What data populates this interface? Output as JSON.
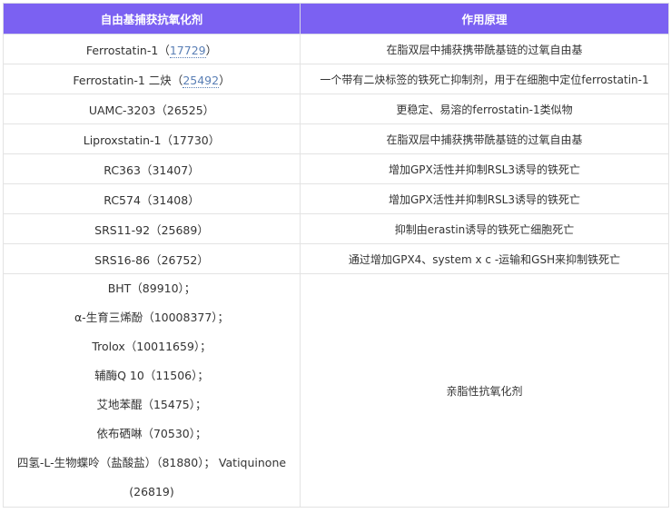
{
  "header": {
    "col1": "自由基捕获抗氧化剂",
    "col2": "作用原理"
  },
  "rows": [
    {
      "name": "Ferrostatin-1",
      "code": "17729",
      "link": true,
      "mechanism": "在脂双层中捕获携带酰基链的过氧自由基"
    },
    {
      "name": "Ferrostatin-1 二炔",
      "code": "25492",
      "link": true,
      "mechanism": "一个带有二炔标签的铁死亡抑制剂，用于在细胞中定位ferrostatin-1"
    },
    {
      "name": "UAMC-3203",
      "code": "26525",
      "link": false,
      "mechanism": "更稳定、易溶的ferrostatin-1类似物"
    },
    {
      "name": "Liproxstatin-1",
      "code": "17730",
      "link": false,
      "mechanism": "在脂双层中捕获携带酰基链的过氧自由基"
    },
    {
      "name": "RC363",
      "code": "31407",
      "link": false,
      "mechanism": "增加GPX活性并抑制RSL3诱导的铁死亡"
    },
    {
      "name": "RC574",
      "code": "31408",
      "link": false,
      "mechanism": "增加GPX活性并抑制RSL3诱导的铁死亡"
    },
    {
      "name": "SRS11-92",
      "code": "25689",
      "link": false,
      "mechanism": "抑制由erastin诱导的铁死亡细胞死亡"
    },
    {
      "name": "SRS16-86",
      "code": "26752",
      "link": false,
      "mechanism": "通过增加GPX4、system x c -运输和GSH来抑制铁死亡"
    }
  ],
  "last_row": {
    "lines": [
      "BHT（89910）；",
      "α-生育三烯酚（10008377）；",
      "Trolox（10011659）；",
      "辅酶Q 10（11506）；",
      "艾地苯醌（15475）；",
      "依布硒啉（70530）；",
      "四氢-L-生物蝶呤（盐酸盐）（81880）； Vatiquinone",
      "(26819)"
    ],
    "mechanism": "亲脂性抗氧化剂"
  }
}
